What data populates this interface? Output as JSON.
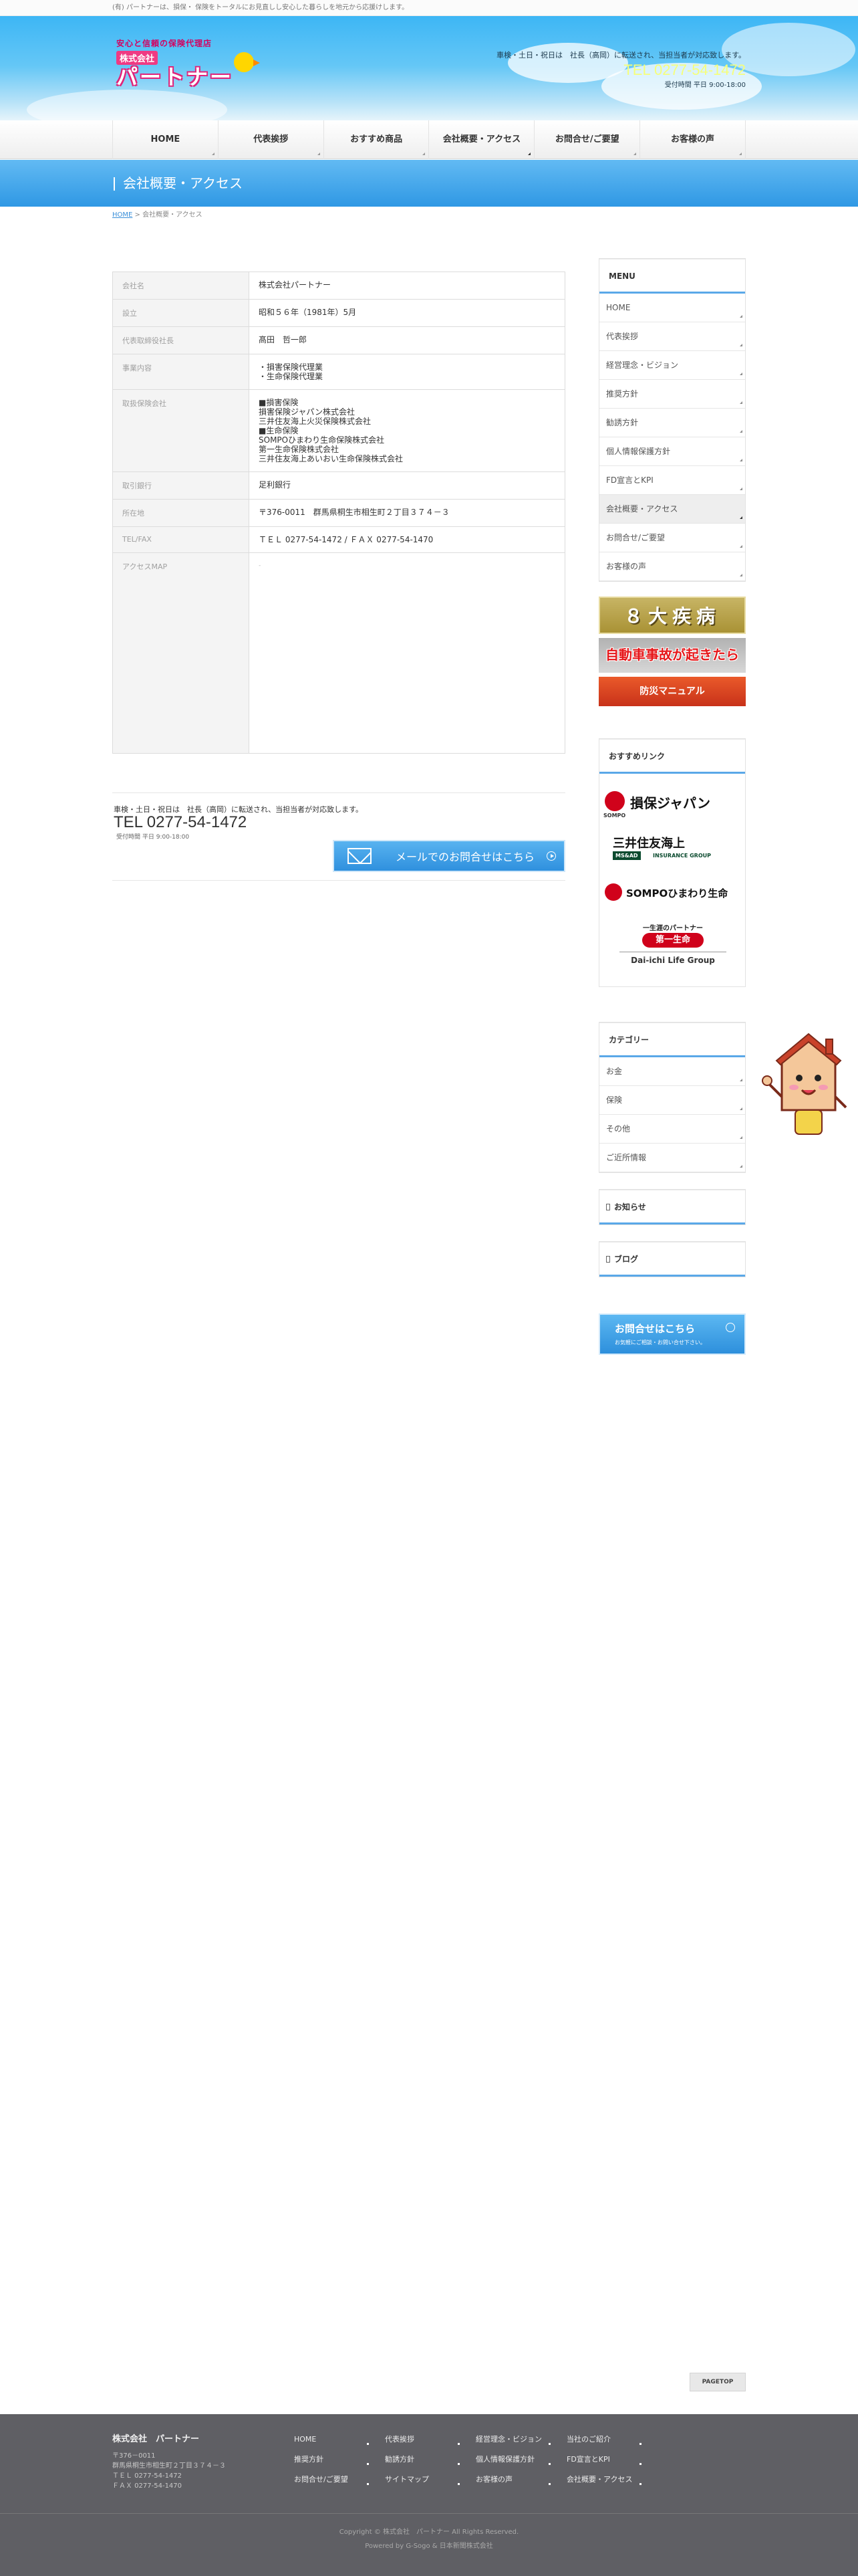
{
  "topbar": {
    "text": "(有) パートナーは、損保・ 保険をトータルにお見直しし安心した暮らしを地元から応援けします。"
  },
  "header": {
    "logo": {
      "tagline": "安心と信頼の保険代理店",
      "small": "株式会社",
      "name": "パートナー"
    },
    "contact_note": "車検・土日・祝日は　社長（高岡）に転送され、当担当者が対応致します。",
    "tel": "TEL 0277-54-1472",
    "hours": "受付時間 平日 9:00-18:00"
  },
  "nav": {
    "items": [
      {
        "label": "HOME"
      },
      {
        "label": "代表挨拶"
      },
      {
        "label": "おすすめ商品"
      },
      {
        "label": "会社概要・アクセス"
      },
      {
        "label": "お問合せ/ご要望"
      },
      {
        "label": "お客様の声"
      }
    ]
  },
  "page": {
    "title": "会社概要・アクセス",
    "breadcrumb_home": "HOME",
    "breadcrumb_sep": " > ",
    "breadcrumb_current": "会社概要・アクセス"
  },
  "company_table": {
    "rows": [
      {
        "label": "会社名",
        "lines": [
          "株式会社パートナー"
        ]
      },
      {
        "label": "設立",
        "lines": [
          "昭和５６年（1981年）5月"
        ]
      },
      {
        "label": "代表取締役社長",
        "lines": [
          "髙田　哲一郎"
        ]
      },
      {
        "label": "事業内容",
        "lines": [
          "・損害保険代理業",
          "・生命保険代理業"
        ]
      },
      {
        "label": "取扱保険会社",
        "lines": [
          "■損害保険",
          "損害保険ジャパン株式会社",
          "三井住友海上火災保険株式会社",
          "■生命保険",
          "SOMPOひまわり生命保険株式会社",
          "第一生命保険株式会社",
          "三井住友海上あいおい生命保険株式会社"
        ]
      },
      {
        "label": "取引銀行",
        "lines": [
          "足利銀行"
        ]
      },
      {
        "label": "所在地",
        "lines": [
          "〒376-0011　群馬県桐生市相生町２丁目３７４－３"
        ]
      },
      {
        "label": "TEL/FAX",
        "lines": [
          "ＴＥＬ 0277-54-1472 / ＦＡＸ 0277-54-1470"
        ]
      },
      {
        "label": "アクセスMAP",
        "lines": [
          "-"
        ]
      }
    ]
  },
  "contact_block": {
    "note": "車検・土日・祝日は　社長（高岡）に転送され、当担当者が対応致します。",
    "tel": "TEL 0277-54-1472",
    "hours": "受付時間 平日 9:00-18:00",
    "mail_button": "メールでのお問合せはこちら"
  },
  "sidebar": {
    "menu_title": "MENU",
    "menu": [
      {
        "label": "HOME"
      },
      {
        "label": "代表挨拶"
      },
      {
        "label": "経営理念・ビジョン"
      },
      {
        "label": "推奨方針"
      },
      {
        "label": "勧誘方針"
      },
      {
        "label": "個人情報保護方針"
      },
      {
        "label": "FD宣言とKPI"
      },
      {
        "label": "会社概要・アクセス"
      },
      {
        "label": "お問合せ/ご要望"
      },
      {
        "label": "お客様の声"
      }
    ],
    "banners": {
      "eight": "８大疾病",
      "car": "自動車事故が起きたら",
      "bousai": "防災マニュアル"
    },
    "links_title": "おすすめリンク",
    "logos": {
      "sompo_sub": "SOMPO",
      "sompo": "損保ジャパン",
      "ms": "三井住友海上",
      "ms_box": "MS&AD",
      "ms_sub": "INSURANCE GROUP",
      "himawari": "SOMPOひまわり生命",
      "daiichi_t1": "一生涯のパートナー",
      "daiichi_t2": "第一生命",
      "daiichi_t3": "Dai-ichi Life Group"
    },
    "category_title": "カテゴリー",
    "categories": [
      {
        "label": "お金"
      },
      {
        "label": "保険"
      },
      {
        "label": "その他"
      },
      {
        "label": "ご近所情報"
      }
    ],
    "news_title": "お知らせ",
    "blog_title": "ブログ",
    "contact_banner_l1": "お問合せはこちら",
    "contact_banner_l2": "お気軽にご相談・お問い合せ下さい。"
  },
  "pagetop": "PAGETOP",
  "footer": {
    "company": "株式会社　パートナー",
    "address_lines": [
      "〒376－0011",
      "群馬県桐生市相生町２丁目３７４－３",
      "ＴＥＬ 0277-54-1472",
      "ＦＡＸ 0277-54-1470"
    ],
    "links": [
      {
        "label": "HOME"
      },
      {
        "label": "代表挨拶"
      },
      {
        "label": "経営理念・ビジョン"
      },
      {
        "label": "当社のご紹介"
      },
      {
        "label": ""
      },
      {
        "label": "推奨方針"
      },
      {
        "label": "勧誘方針"
      },
      {
        "label": "個人情報保護方針"
      },
      {
        "label": "FD宣言とKPI"
      },
      {
        "label": ""
      },
      {
        "label": "お問合せ/ご要望"
      },
      {
        "label": "サイトマップ"
      },
      {
        "label": "お客様の声"
      },
      {
        "label": "会社概要・アクセス"
      },
      {
        "label": ""
      }
    ],
    "copyright": "Copyright © 株式会社　パートナー All Rights Reserved.",
    "powered": "Powered by G-Sogo & 日本新聞株式会社"
  }
}
